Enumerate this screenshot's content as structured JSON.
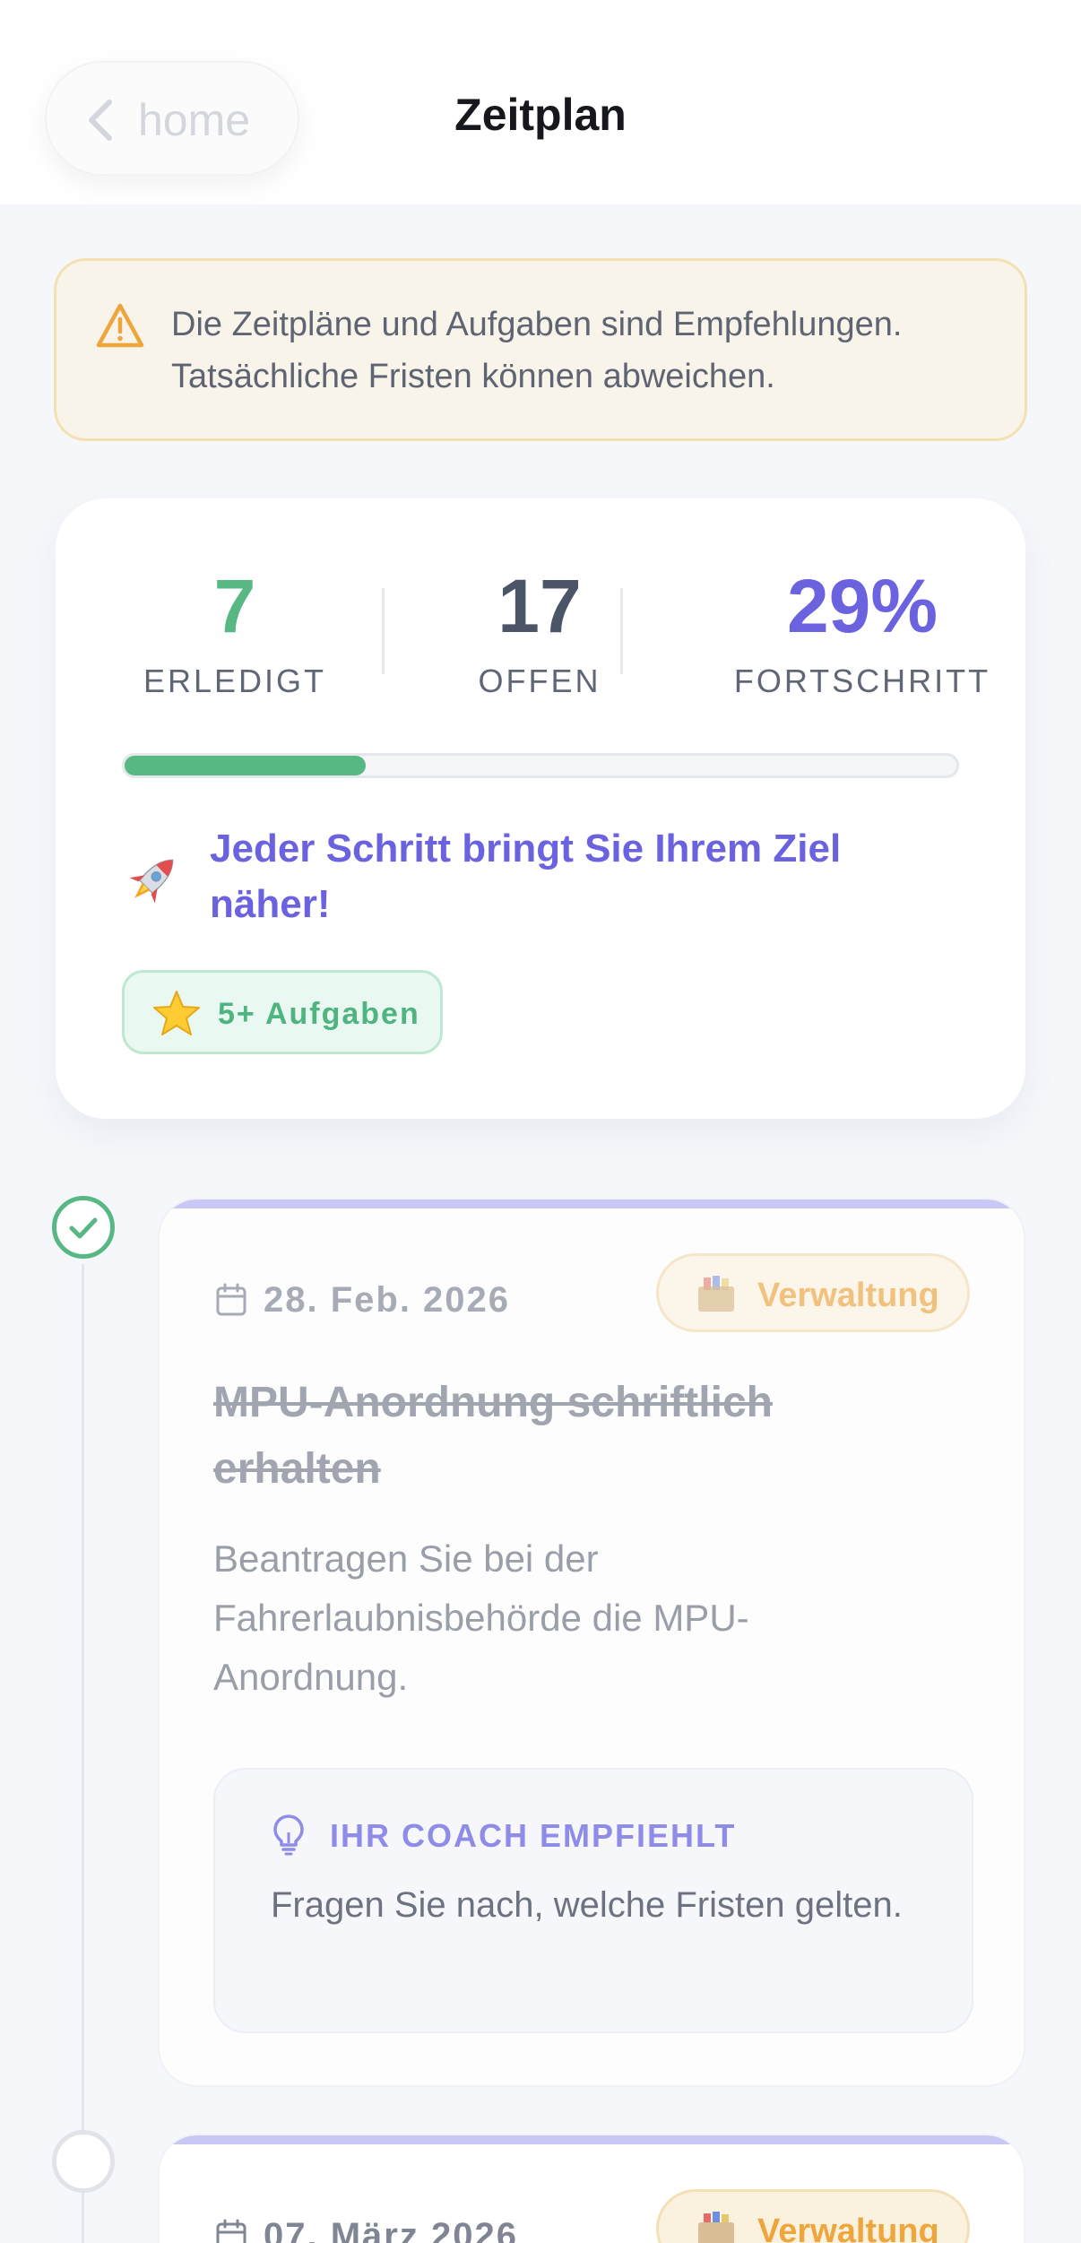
{
  "header": {
    "back_label": "home",
    "title": "Zeitplan"
  },
  "disclaimer": {
    "icon": "warning-triangle-icon",
    "text": "Die Zeitpläne und Aufgaben sind Empfehlungen. Tatsächliche Fristen können abweichen."
  },
  "stats": {
    "done_value": "7",
    "done_label": "ERLEDIGT",
    "open_value": "17",
    "open_label": "OFFEN",
    "progress_value": "29%",
    "progress_label": "FORTSCHRITT",
    "progress_fraction": 0.29,
    "motivation": "Jeder Schritt bringt Sie Ihrem Ziel näher!",
    "badge_label": "5+ Aufgaben",
    "colors": {
      "done": "#57b883",
      "open": "#4c5468",
      "progress": "#6a62df"
    }
  },
  "tasks": [
    {
      "status": "done",
      "date": "28. Feb. 2026",
      "category": "Verwaltung",
      "title": "MPU-Anordnung schriftlich erhalten",
      "description": "Beantragen Sie bei der Fahrerlaubnisbehörde die MPU-Anordnung.",
      "coach_heading": "IHR COACH EMPFIEHLT",
      "coach_text": "Fragen Sie nach, welche Fristen gelten."
    },
    {
      "status": "open",
      "date": "07. März 2026",
      "category": "Verwaltung"
    }
  ]
}
